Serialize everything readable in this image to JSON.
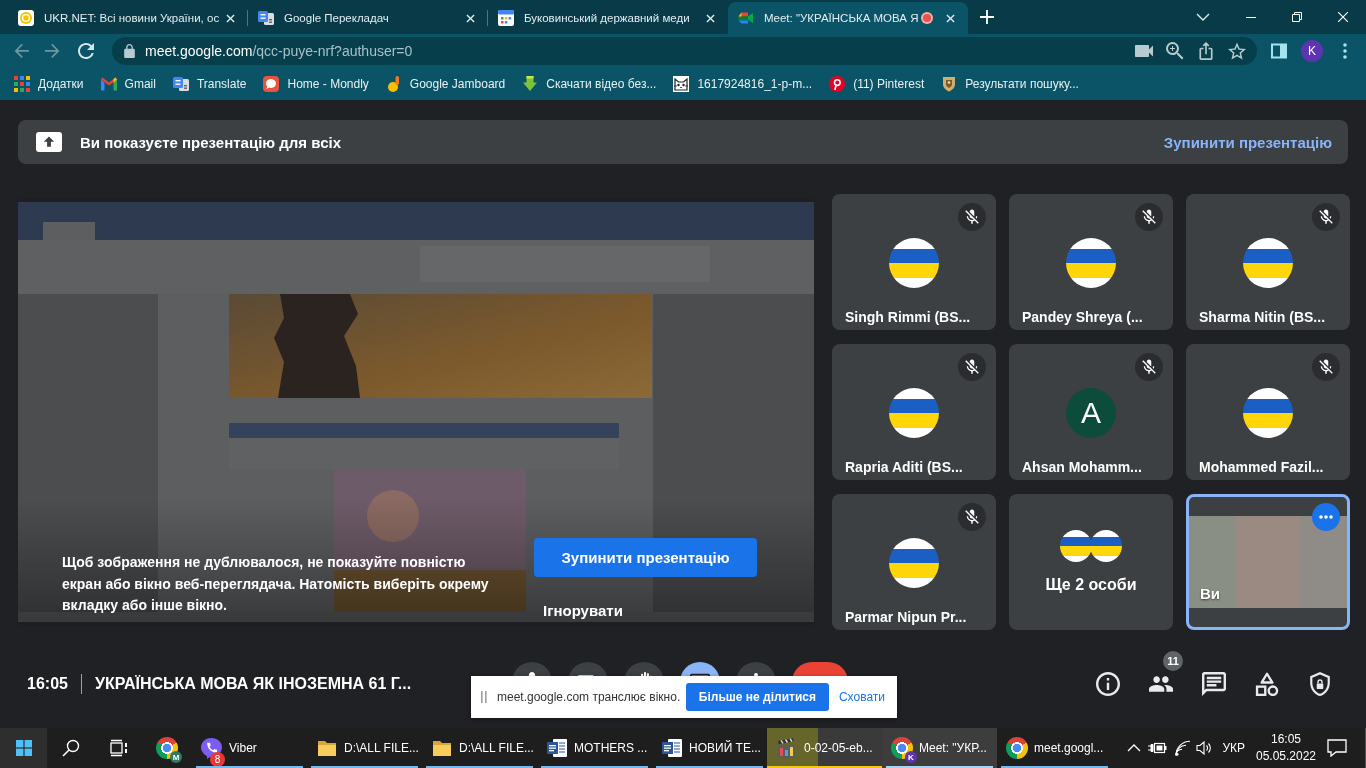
{
  "browser": {
    "tabs": [
      {
        "title": "UKR.NET: Всі новини України, ос",
        "selected": false,
        "recording": false
      },
      {
        "title": "Google Перекладач",
        "selected": false,
        "recording": false
      },
      {
        "title": "Буковинський державний меди",
        "selected": false,
        "recording": false
      },
      {
        "title": "Meet: \"УКРАЇНСЬКА МОВА Я",
        "selected": true,
        "recording": true
      }
    ],
    "address": {
      "host": "meet.google.com",
      "path": "/qcc-puye-nrf?authuser=0"
    },
    "profile_initial": "K",
    "bookmarks": [
      {
        "label": "Додатки"
      },
      {
        "label": "Gmail"
      },
      {
        "label": "Translate"
      },
      {
        "label": "Home - Mondly"
      },
      {
        "label": "Google Jamboard"
      },
      {
        "label": "Скачати відео без..."
      },
      {
        "label": "1617924816_1-p-m..."
      },
      {
        "label": "(11) Pinterest"
      },
      {
        "label": "Результати пошуку..."
      }
    ]
  },
  "meet": {
    "banner": {
      "text": "Ви показуєте презентацію для всіх",
      "action": "Зупинити презентацію"
    },
    "share_warning": {
      "text": "Щоб зображення не дублювалося, не показуйте повністю екран або вікно веб-переглядача. Натомість виберіть окрему вкладку або інше вікно.",
      "primary": "Зупинити презентацію",
      "secondary": "Ігнорувати"
    },
    "participants": [
      {
        "kind": "participant",
        "name": "Singh Rimmi (BS...",
        "avatar": {
          "kind": "flag"
        },
        "muted": true,
        "highlighted": false
      },
      {
        "kind": "participant",
        "name": "Pandey Shreya (...",
        "avatar": {
          "kind": "flag"
        },
        "muted": true,
        "highlighted": false
      },
      {
        "kind": "participant",
        "name": "Sharma Nitin (BS...",
        "avatar": {
          "kind": "flag"
        },
        "muted": true,
        "highlighted": false
      },
      {
        "kind": "participant",
        "name": "Rapria Aditi (BS...",
        "avatar": {
          "kind": "flag"
        },
        "muted": true,
        "highlighted": false
      },
      {
        "kind": "participant",
        "name": "Ahsan Mohamm...",
        "avatar": {
          "kind": "letter",
          "initial": "A",
          "color": "#0d4b3b"
        },
        "muted": true,
        "highlighted": false
      },
      {
        "kind": "participant",
        "name": "Mohammed Fazil...",
        "avatar": {
          "kind": "flag"
        },
        "muted": true,
        "highlighted": false
      },
      {
        "kind": "participant",
        "name": "Parmar Nipun Pr...",
        "avatar": {
          "kind": "flag"
        },
        "muted": true,
        "highlighted": false
      },
      {
        "kind": "overflow",
        "label": "Ще 2 особи",
        "avatars": [
          {
            "kind": "flag"
          },
          {
            "kind": "flag"
          }
        ],
        "muted": false,
        "highlighted": false
      },
      {
        "kind": "self",
        "name": "Ви",
        "muted": false,
        "highlighted": true
      }
    ],
    "meeting": {
      "time": "16:05",
      "title": "УКРАЇНСЬКА МОВА ЯК ІНОЗЕМНА 61 Г..."
    },
    "controls": [
      {
        "kind": "mic",
        "active": false
      },
      {
        "kind": "camera",
        "active": false
      },
      {
        "kind": "hand",
        "active": false
      },
      {
        "kind": "present",
        "active": true
      },
      {
        "kind": "more",
        "active": false
      },
      {
        "kind": "leave",
        "active": false
      }
    ],
    "people_count": "11"
  },
  "sharing_bar": {
    "text": "meet.google.com транслює вікно.",
    "stop": "Більше не ділитися",
    "hide": "Сховати"
  },
  "taskbar": {
    "pinned_profile": "M",
    "apps": [
      {
        "kind": "viber",
        "label": "Viber",
        "badge": "8",
        "selected": false,
        "flashing": false
      },
      {
        "kind": "folder",
        "label": "D:\\ALL FILE...",
        "selected": false,
        "flashing": false
      },
      {
        "kind": "folder",
        "label": "D:\\ALL FILE...",
        "selected": false,
        "flashing": false
      },
      {
        "kind": "word",
        "label": "MOTHERS ...",
        "selected": false,
        "flashing": false
      },
      {
        "kind": "word",
        "label": "НОВИЙ ТЕ...",
        "selected": false,
        "flashing": false
      },
      {
        "kind": "video",
        "label": "0-02-05-eb...",
        "selected": false,
        "flashing": true
      },
      {
        "kind": "chrome",
        "label": "Meet: \"УКР...",
        "profile": "K",
        "selected": true,
        "flashing": false
      },
      {
        "kind": "chrome",
        "label": "meet.googl...",
        "selected": false,
        "flashing": false
      }
    ],
    "language": "УКР",
    "time": "16:05",
    "date": "05.05.2022"
  }
}
